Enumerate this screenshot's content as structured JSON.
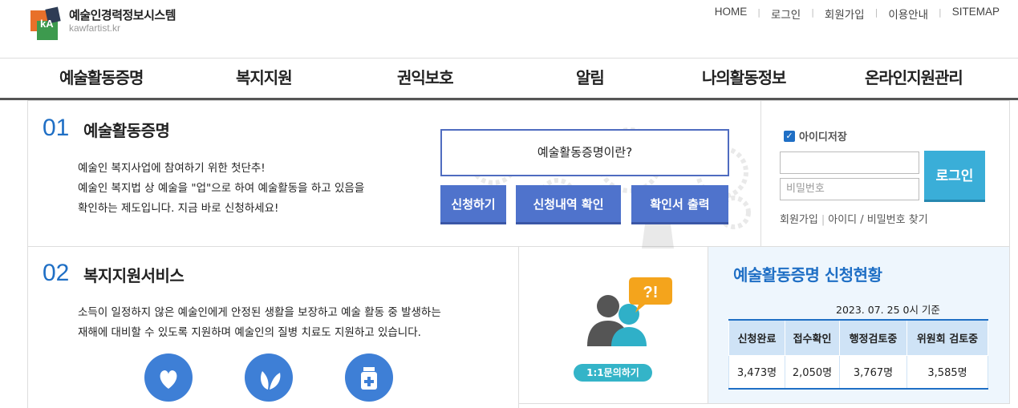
{
  "header": {
    "logo_title": "예술인경력정보시스템",
    "logo_sub": "kawfartist.kr",
    "logo_mark": "kA",
    "top_links": [
      "HOME",
      "로그인",
      "회원가입",
      "이용안내",
      "SITEMAP"
    ]
  },
  "nav": [
    "예술활동증명",
    "복지지원",
    "권익보호",
    "알림",
    "나의활동정보",
    "온라인지원관리"
  ],
  "section1": {
    "num": "01",
    "title": "예술활동증명",
    "desc": [
      "예술인 복지사업에 참여하기 위한 첫단추!",
      "예술인 복지법 상 예술을 \"업\"으로 하여 예술활동을 하고 있음을",
      "확인하는 제도입니다. 지금 바로 신청하세요!"
    ],
    "what_label": "예술활동증명이란?",
    "buttons": [
      "신청하기",
      "신청내역 확인",
      "확인서 출력"
    ]
  },
  "login": {
    "remember_label": "아이디저장",
    "remember_checked": true,
    "id_placeholder": "",
    "pw_placeholder": "비밀번호",
    "login_label": "로그인",
    "join_label": "회원가입",
    "find_label": "아이디 / 비밀번호 찾기"
  },
  "section2": {
    "num": "02",
    "title": "복지지원서비스",
    "desc": [
      "소득이 일정하지 않은 예술인에게 안정된 생활을 보장하고 예술 활동 중 발생하는",
      "재해에 대비할 수 있도록 지원하며 예술인의 질병 치료도 지원하고 있습니다."
    ],
    "icons": [
      "heart-icon",
      "leaf-icon",
      "medicine-icon"
    ]
  },
  "inquiry": {
    "badge": "?!",
    "label": "1:1문의하기"
  },
  "stats": {
    "title": "예술활동증명 신청현황",
    "date": "2023. 07. 25   0시 기준",
    "headers": [
      "신청완료",
      "접수확인",
      "행정검토중",
      "위원회 검토중"
    ],
    "values": [
      "3,473명",
      "2,050명",
      "3,767명",
      "3,585명"
    ]
  },
  "colors": {
    "accent": "#1f6fc5",
    "button_blue": "#4f73cc",
    "login_btn": "#3aaed8",
    "stats_bg": "#eef6fd"
  }
}
